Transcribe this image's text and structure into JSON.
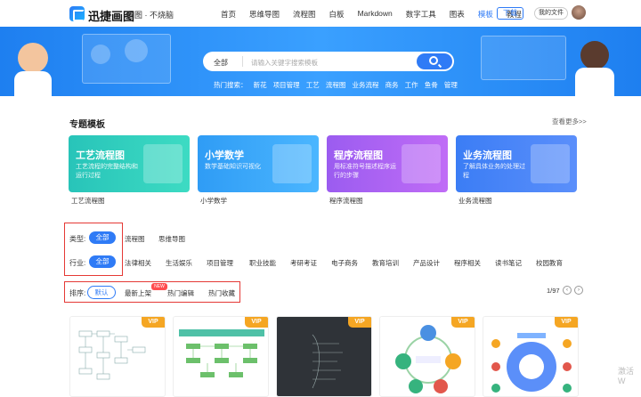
{
  "header": {
    "brand": "迅捷画图",
    "subtitle": "脑图 · 不烧脑",
    "nav": [
      {
        "label": "首页",
        "active": false
      },
      {
        "label": "思维导图",
        "active": false
      },
      {
        "label": "流程图",
        "active": false
      },
      {
        "label": "白板",
        "active": false
      },
      {
        "label": "Markdown",
        "active": false
      },
      {
        "label": "数字工具",
        "active": false
      },
      {
        "label": "图表",
        "active": false
      },
      {
        "label": "模板",
        "active": true
      },
      {
        "label": "教程",
        "active": false
      }
    ],
    "download_label": "下载",
    "myfile_label": "我的文件"
  },
  "search": {
    "scope": "全部",
    "placeholder": "请输入关键字搜索模板",
    "hot_label": "热门搜索：",
    "hot_terms": [
      "新花",
      "项目管理",
      "工艺",
      "流程图",
      "业务流程",
      "商务",
      "工作",
      "鱼骨",
      "管理"
    ]
  },
  "featured": {
    "title": "专题模板",
    "more": "查看更多>>",
    "cards": [
      {
        "title": "工艺流程图",
        "desc": "工艺流程的完整结构和运行过程",
        "caption": "工艺流程图",
        "color_from": "#28c4b9",
        "color_to": "#3ddbc3"
      },
      {
        "title": "小学数学",
        "desc": "数学基础知识可视化",
        "caption": "小学数学",
        "color_from": "#2f9cf5",
        "color_to": "#4bb6ff"
      },
      {
        "title": "程序流程图",
        "desc": "用标准符号描述程序运行的步骤",
        "caption": "程序流程图",
        "color_from": "#9b5cf0",
        "color_to": "#c06cf6"
      },
      {
        "title": "业务流程图",
        "desc": "了解具体业务的处理过程",
        "caption": "业务流程图",
        "color_from": "#3b7df5",
        "color_to": "#5b8ffb"
      }
    ]
  },
  "filters": {
    "type_label": "类型:",
    "type_all": "全部",
    "type_options": [
      "流程图",
      "思维导图"
    ],
    "industry_label": "行业:",
    "industry_all": "全部",
    "industry_options": [
      "法律相关",
      "生活娱乐",
      "项目管理",
      "职业技能",
      "考研考证",
      "电子商务",
      "教育培训",
      "产品设计",
      "程序相关",
      "读书笔记",
      "校园教育"
    ]
  },
  "sort": {
    "label": "排序:",
    "default": "默认",
    "options": [
      "最新上架",
      "热门编辑",
      "热门收藏"
    ],
    "new_tag": "NEW"
  },
  "pager": {
    "text": "1/97"
  },
  "thumbs": [
    {
      "vip": "VIP"
    },
    {
      "vip": "VIP"
    },
    {
      "vip": "VIP"
    },
    {
      "vip": "VIP"
    },
    {
      "vip": "VIP"
    }
  ],
  "watermark": "激活 W"
}
